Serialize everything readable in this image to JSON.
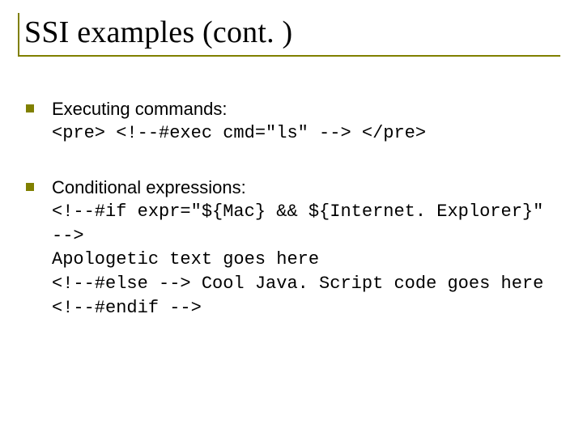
{
  "title": "SSI examples (cont. )",
  "items": [
    {
      "lead": "Executing commands:",
      "code": "<pre> <!--#exec cmd=\"ls\" --> </pre>"
    },
    {
      "lead": "Conditional expressions:",
      "code": "<!--#if expr=\"${Mac} && ${Internet. Explorer}\" -->\nApologetic text goes here\n<!--#else --> Cool Java. Script code goes here\n<!--#endif -->"
    }
  ]
}
